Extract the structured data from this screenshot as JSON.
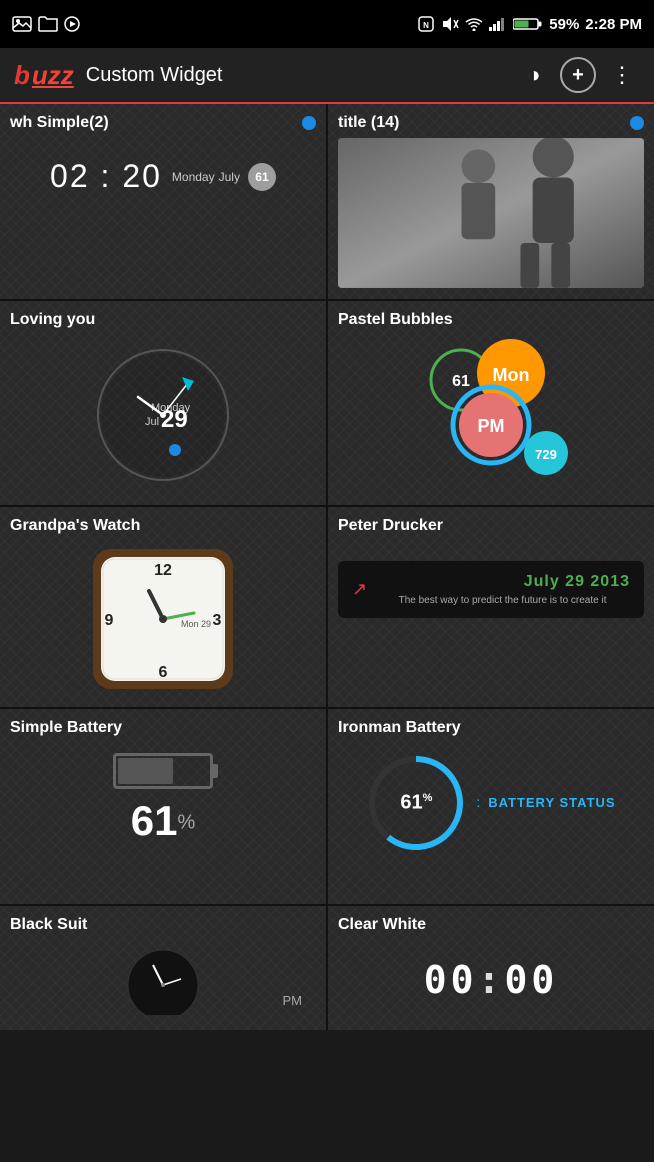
{
  "statusBar": {
    "time": "2:28 PM",
    "battery": "59%",
    "icons": [
      "image-icon",
      "folder-icon",
      "play-icon",
      "nfc-icon",
      "mute-icon",
      "wifi-icon",
      "signal-icon"
    ]
  },
  "header": {
    "logoB": "b",
    "logoRest": "uzz",
    "title": "Custom Widget",
    "btnHalf": "◑",
    "btnPlus": "+",
    "btnMore": "⋮"
  },
  "widgets": [
    {
      "id": "wh-simple",
      "title": "wh Simple(2)",
      "time": "02 : 20",
      "day": "Monday",
      "month": "July",
      "badge": "61"
    },
    {
      "id": "title",
      "title": "title (14)"
    },
    {
      "id": "loving-you",
      "title": "Loving you",
      "day": "Monday",
      "date": "29",
      "month": "Jul"
    },
    {
      "id": "pastel-bubbles",
      "title": "Pastel Bubbles",
      "badge61": "61",
      "mon": "Mon",
      "pm": "PM",
      "num729": "729"
    },
    {
      "id": "grandpas-watch",
      "title": "Grandpa's Watch"
    },
    {
      "id": "peter-drucker",
      "title": "Peter Drucker",
      "date": "July  29  2013",
      "quote": "The best way to predict the future is to create it"
    },
    {
      "id": "simple-battery",
      "title": "Simple Battery",
      "percent": "61",
      "percentSymbol": "%"
    },
    {
      "id": "ironman-battery",
      "title": "Ironman Battery",
      "percent": "61",
      "percentSymbol": "%",
      "statusLabel": "BATTERY STATUS"
    },
    {
      "id": "black-suit",
      "title": "Black Suit",
      "pmLabel": "PM"
    },
    {
      "id": "clear-white",
      "title": "Clear White",
      "time": "00:00"
    }
  ]
}
